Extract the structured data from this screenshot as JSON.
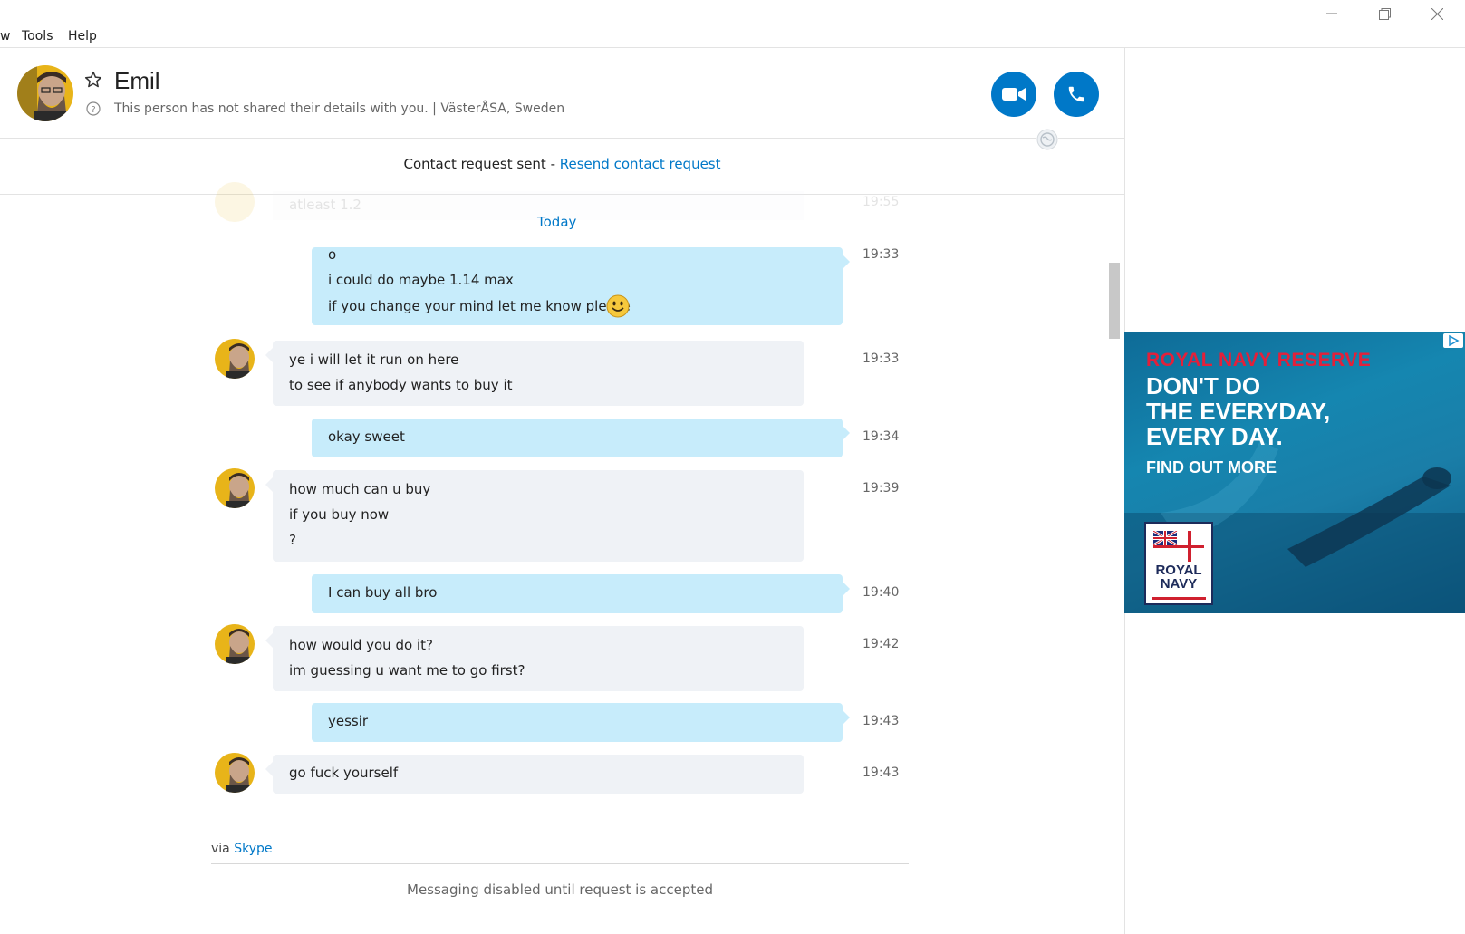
{
  "menu": {
    "partial": "w",
    "tools": "Tools",
    "help": "Help"
  },
  "contact": {
    "name": "Emil",
    "details": "This person has not shared their details with you.  |  VästerÅSA, Sweden"
  },
  "banner": {
    "text": "Contact request sent - ",
    "link": "Resend contact request"
  },
  "chat": {
    "faded_text": "atleast 1.2",
    "faded_time": "19:55",
    "day_separator": "Today",
    "messages": [
      {
        "dir": "out",
        "time": "19:33",
        "lines": [
          "o",
          "i could do maybe 1.14 max",
          "if you change your mind let me know please"
        ],
        "emoji": "smile"
      },
      {
        "dir": "in",
        "time": "19:33",
        "lines": [
          "ye i will let it run on here",
          "to see if anybody wants to buy it"
        ]
      },
      {
        "dir": "out",
        "time": "19:34",
        "lines": [
          "okay sweet"
        ]
      },
      {
        "dir": "in",
        "time": "19:39",
        "lines": [
          "how much can u buy",
          "if you buy now",
          "?"
        ]
      },
      {
        "dir": "out",
        "time": "19:40",
        "lines": [
          "I can buy all bro"
        ]
      },
      {
        "dir": "in",
        "time": "19:42",
        "lines": [
          "how would you do it?",
          "im guessing u want me to go first?"
        ]
      },
      {
        "dir": "out",
        "time": "19:43",
        "lines": [
          "yessir"
        ]
      },
      {
        "dir": "in",
        "time": "19:43",
        "lines": [
          "go fuck yourself"
        ]
      }
    ]
  },
  "footer": {
    "via": "via ",
    "via_link": "Skype",
    "disabled": "Messaging disabled until request is accepted"
  },
  "ad": {
    "headline_red": "ROYAL NAVY RESERVE",
    "headline_1": "DON'T DO",
    "headline_2": "THE EVERYDAY,",
    "headline_3": "EVERY DAY.",
    "cta": "FIND OUT MORE",
    "logo_1": "ROYAL",
    "logo_2": "NAVY"
  },
  "colors": {
    "accent": "#0078c8",
    "outgoing_bubble": "#c7ecfb",
    "incoming_bubble": "#eff2f6"
  }
}
